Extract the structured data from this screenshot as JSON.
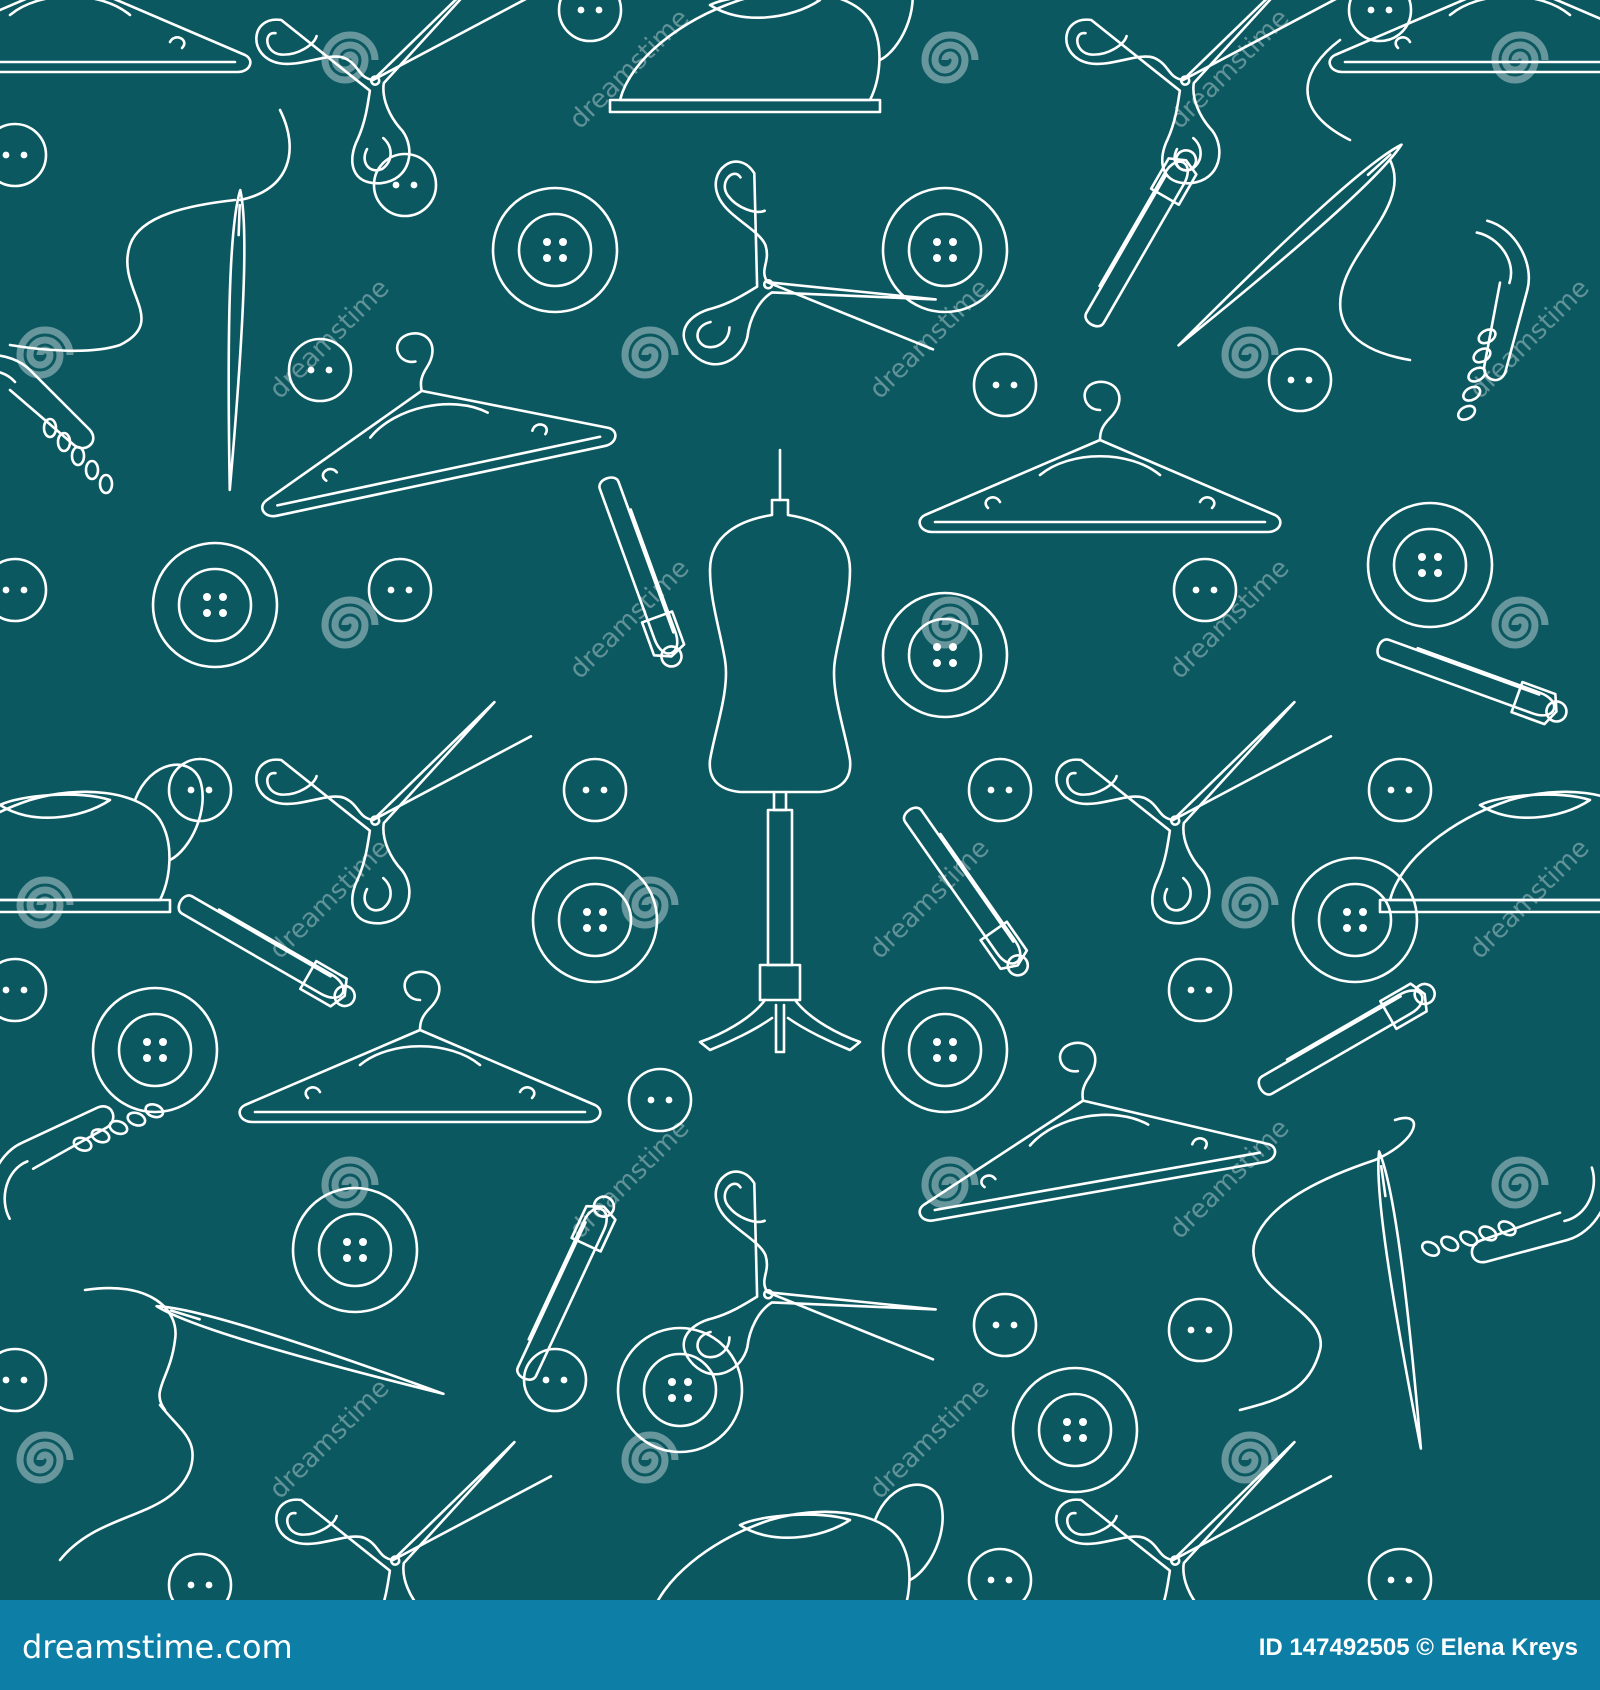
{
  "pattern": {
    "background_color": "#0b5860",
    "line_color": "#ffffff",
    "motifs": [
      "mannequin-icon",
      "scissors-icon",
      "button-icon",
      "hanger-icon",
      "safety-pin-icon",
      "needle-thread-icon",
      "iron-icon",
      "zipper-icon"
    ]
  },
  "watermark": {
    "text": "dreamstime",
    "color": "rgba(255,255,255,0.35)"
  },
  "footer": {
    "background_color": "#0d7ea6",
    "site": "dreamstime.com",
    "id_label": "ID",
    "id": "147492505",
    "author": "© Elena Kreys"
  }
}
